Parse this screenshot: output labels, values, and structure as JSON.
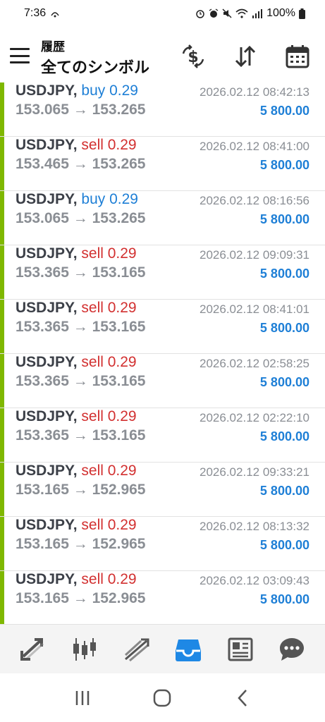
{
  "statusbar": {
    "time": "7:36",
    "battery": "100%"
  },
  "header": {
    "title_small": "履歴",
    "title_big": "全てのシンボル"
  },
  "colors": {
    "accent_bar": "#7fb800",
    "buy": "#1e7fd6",
    "sell": "#d23030",
    "profit": "#1e7fd6"
  },
  "deals": [
    {
      "symbol": "USDJPY,",
      "side": "buy",
      "side_label": "buy 0.29",
      "prices": "153.065 → 153.265",
      "time": "2026.02.12 08:42:13",
      "profit": "5 800.00"
    },
    {
      "symbol": "USDJPY,",
      "side": "sell",
      "side_label": "sell 0.29",
      "prices": "153.465 → 153.265",
      "time": "2026.02.12 08:41:00",
      "profit": "5 800.00"
    },
    {
      "symbol": "USDJPY,",
      "side": "buy",
      "side_label": "buy 0.29",
      "prices": "153.065 → 153.265",
      "time": "2026.02.12 08:16:56",
      "profit": "5 800.00"
    },
    {
      "symbol": "USDJPY,",
      "side": "sell",
      "side_label": "sell 0.29",
      "prices": "153.365 → 153.165",
      "time": "2026.02.12 09:09:31",
      "profit": "5 800.00"
    },
    {
      "symbol": "USDJPY,",
      "side": "sell",
      "side_label": "sell 0.29",
      "prices": "153.365 → 153.165",
      "time": "2026.02.12 08:41:01",
      "profit": "5 800.00"
    },
    {
      "symbol": "USDJPY,",
      "side": "sell",
      "side_label": "sell 0.29",
      "prices": "153.365 → 153.165",
      "time": "2026.02.12 02:58:25",
      "profit": "5 800.00"
    },
    {
      "symbol": "USDJPY,",
      "side": "sell",
      "side_label": "sell 0.29",
      "prices": "153.365 → 153.165",
      "time": "2026.02.12 02:22:10",
      "profit": "5 800.00"
    },
    {
      "symbol": "USDJPY,",
      "side": "sell",
      "side_label": "sell 0.29",
      "prices": "153.165 → 152.965",
      "time": "2026.02.12 09:33:21",
      "profit": "5 800.00"
    },
    {
      "symbol": "USDJPY,",
      "side": "sell",
      "side_label": "sell 0.29",
      "prices": "153.165 → 152.965",
      "time": "2026.02.12 08:13:32",
      "profit": "5 800.00"
    },
    {
      "symbol": "USDJPY,",
      "side": "sell",
      "side_label": "sell 0.29",
      "prices": "153.165 → 152.965",
      "time": "2026.02.12 03:09:43",
      "profit": "5 800.00"
    }
  ],
  "icons": {
    "appbar": [
      "currency-exchange-icon",
      "sort-icon",
      "calendar-icon"
    ],
    "bottomnav": [
      "quotes-icon",
      "chart-icon",
      "trade-icon",
      "history-icon",
      "news-icon",
      "chat-icon"
    ],
    "active_tab": "history-icon"
  }
}
